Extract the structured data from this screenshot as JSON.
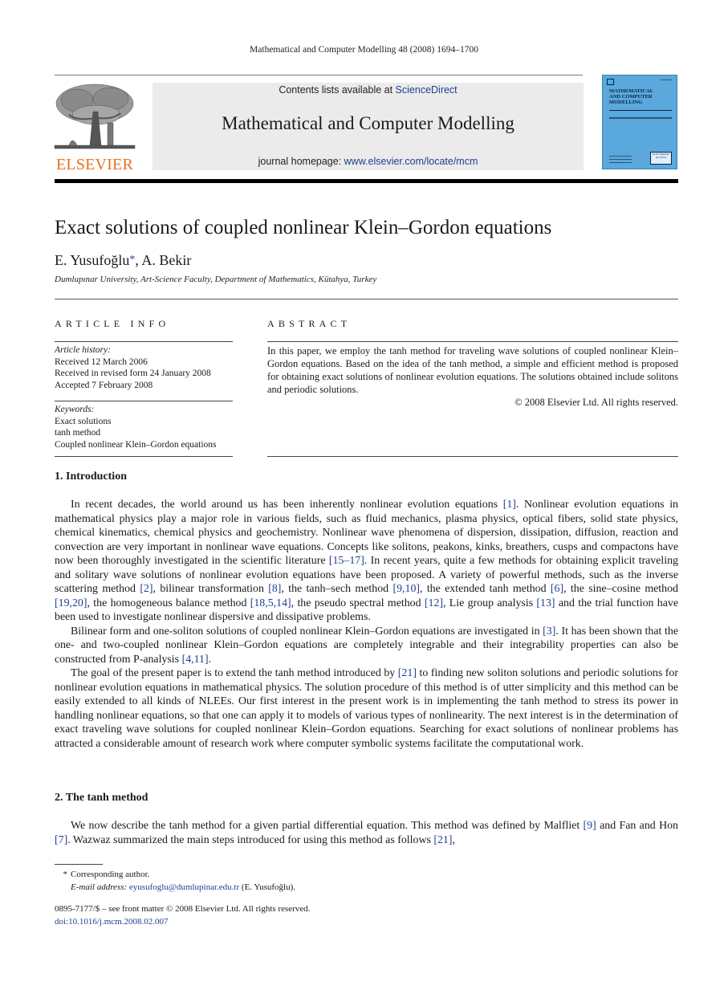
{
  "running_head": "Mathematical and Computer Modelling 48 (2008) 1694–1700",
  "header": {
    "publisher_logo_text": "ELSEVIER",
    "publisher_logo_icon": "tree-icon",
    "contents_prefix": "Contents lists available at ",
    "contents_link": "ScienceDirect",
    "journal_name": "Mathematical and Computer Modelling",
    "homepage_prefix": "journal homepage: ",
    "homepage_link": "www.elsevier.com/locate/mcm",
    "cover": {
      "title_line1": "MATHEMATICAL",
      "title_line2": "AND COMPUTER",
      "title_line3": "MODELLING",
      "badge": "ELECTRONIC ACCESS"
    }
  },
  "article": {
    "title": "Exact solutions of coupled nonlinear Klein–Gordon equations",
    "author1": "E. Yusufoğlu",
    "author_star": "*",
    "author_sep": ", ",
    "author2": "A. Bekir",
    "affiliation": "Dumlupınar University, Art-Science Faculty, Department of Mathematics, Kütahya, Turkey"
  },
  "article_info": {
    "label": "ARTICLE INFO",
    "history_label": "Article history:",
    "history": [
      "Received 12 March 2006",
      "Received in revised form 24 January 2008",
      "Accepted 7 February 2008"
    ],
    "keywords_label": "Keywords:",
    "keywords": [
      "Exact solutions",
      "tanh method",
      "Coupled nonlinear Klein–Gordon equations"
    ]
  },
  "abstract": {
    "label": "ABSTRACT",
    "text": "In this paper, we employ the tanh method for traveling wave solutions of coupled nonlinear Klein–Gordon equations. Based on the idea of the tanh method, a simple and efficient method is proposed for obtaining exact solutions of nonlinear evolution equations. The solutions obtained include solitons and periodic solutions.",
    "copyright": "© 2008 Elsevier Ltd. All rights reserved."
  },
  "sections": [
    {
      "heading": "1.  Introduction",
      "paragraphs": [
        [
          {
            "t": "In recent decades, the world around us has been inherently nonlinear evolution equations "
          },
          {
            "ref": "[1]"
          },
          {
            "t": ". Nonlinear evolution equations in mathematical physics play a major role in various fields, such as fluid mechanics, plasma physics, optical fibers, solid state physics, chemical kinematics, chemical physics and geochemistry. Nonlinear wave phenomena of dispersion, dissipation, diffusion, reaction and convection are very important in nonlinear wave equations. Concepts like solitons, peakons, kinks, breathers, cusps and compactons have now been thoroughly investigated in the scientific literature "
          },
          {
            "ref": "[15–17]"
          },
          {
            "t": ". In recent years, quite a few methods for obtaining explicit traveling and solitary wave solutions of nonlinear evolution equations have been proposed. A variety of powerful methods, such as the inverse scattering method "
          },
          {
            "ref": "[2]"
          },
          {
            "t": ", bilinear transformation "
          },
          {
            "ref": "[8]"
          },
          {
            "t": ", the tanh–sech method "
          },
          {
            "ref": "[9,10]"
          },
          {
            "t": ", the extended tanh method "
          },
          {
            "ref": "[6]"
          },
          {
            "t": ", the sine–cosine method "
          },
          {
            "ref": "[19,20]"
          },
          {
            "t": ", the homogeneous balance method "
          },
          {
            "ref": "[18,5,14]"
          },
          {
            "t": ", the pseudo spectral method "
          },
          {
            "ref": "[12]"
          },
          {
            "t": ", Lie group analysis "
          },
          {
            "ref": "[13]"
          },
          {
            "t": " and the trial function have been used to investigate nonlinear dispersive and dissipative problems."
          }
        ],
        [
          {
            "t": "Bilinear form and one-soliton solutions of coupled nonlinear Klein–Gordon equations are investigated in "
          },
          {
            "ref": "[3]"
          },
          {
            "t": ". It has been shown that the one- and two-coupled nonlinear Klein–Gordon equations are completely integrable and their integrability properties can also be constructed from P-analysis "
          },
          {
            "ref": "[4,11]"
          },
          {
            "t": "."
          }
        ],
        [
          {
            "t": "The goal of the present paper is to extend the tanh method introduced by "
          },
          {
            "ref": "[21]"
          },
          {
            "t": " to finding new soliton solutions and periodic solutions for nonlinear evolution equations in mathematical physics. The solution procedure of this method is of utter simplicity and this method can be easily extended to all kinds of NLEEs. Our first interest in the present work is in implementing the tanh method to stress its power in handling nonlinear equations, so that one can apply it to models of various types of nonlinearity. The next interest is in the determination of exact traveling wave solutions for coupled nonlinear Klein–Gordon equations. Searching for exact solutions of nonlinear problems has attracted a considerable amount of research work where computer symbolic systems facilitate the computational work."
          }
        ]
      ]
    },
    {
      "heading": "2.  The tanh method",
      "paragraphs": [
        [
          {
            "t": "We now describe the tanh method for a given partial differential equation. This method was defined by Malfliet "
          },
          {
            "ref": "[9]"
          },
          {
            "t": " and Fan and Hon "
          },
          {
            "ref": "[7]"
          },
          {
            "t": ". Wazwaz summarized the main steps introduced for using this method as follows "
          },
          {
            "ref": "[21]"
          },
          {
            "t": ","
          }
        ]
      ]
    }
  ],
  "footnotes": {
    "star": "*",
    "corresponding": "Corresponding author.",
    "email_label": "E-mail address: ",
    "email": "eyusufoglu@dumlupinar.edu.tr",
    "email_suffix": " (E. Yusufoğlu).",
    "issn_line": "0895-7177/$ – see front matter © 2008 Elsevier Ltd. All rights reserved.",
    "doi": "doi:10.1016/j.mcm.2008.02.007"
  },
  "colors": {
    "link": "#1f3f8f",
    "elsevier_orange": "#e9711c",
    "journal_box_bg": "#ebebeb",
    "cover_blue": "#5aa8dc"
  }
}
